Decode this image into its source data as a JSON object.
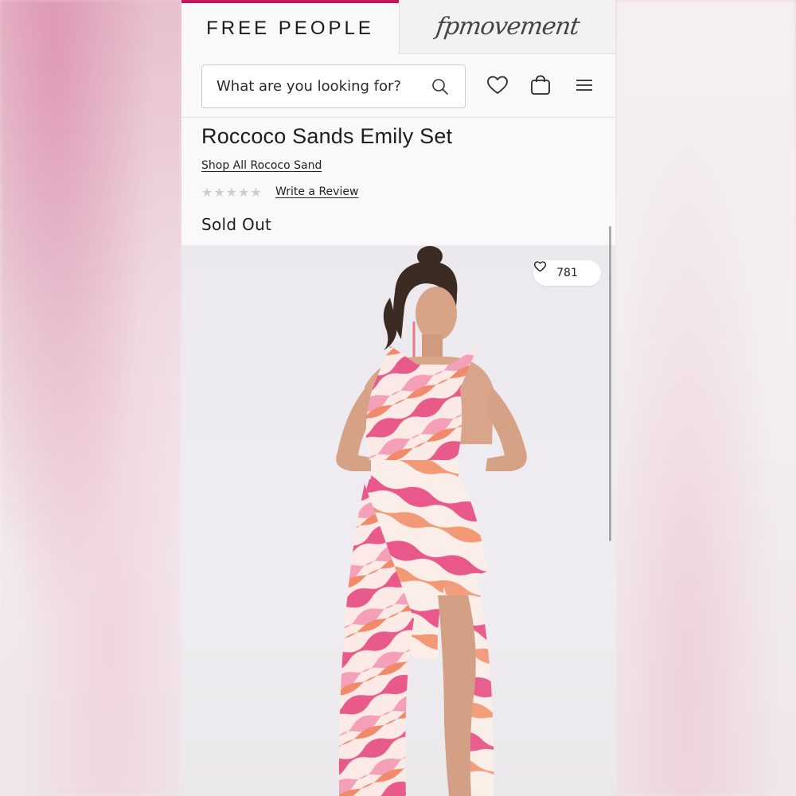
{
  "tabs": {
    "free_people": "FREE PEOPLE",
    "fp_movement": "fpmovement"
  },
  "search": {
    "placeholder": "What are you looking for?"
  },
  "product": {
    "title": "Roccoco Sands Emily Set",
    "shop_link": "Shop All Rococo Sand",
    "rating": 0,
    "rating_max": 5,
    "review_link": "Write a Review",
    "status": "Sold Out",
    "likes": "781"
  },
  "colors": {
    "brand_accent": "#c2185b",
    "print_pink": "#e85a8a",
    "print_coral": "#f08a6a"
  }
}
